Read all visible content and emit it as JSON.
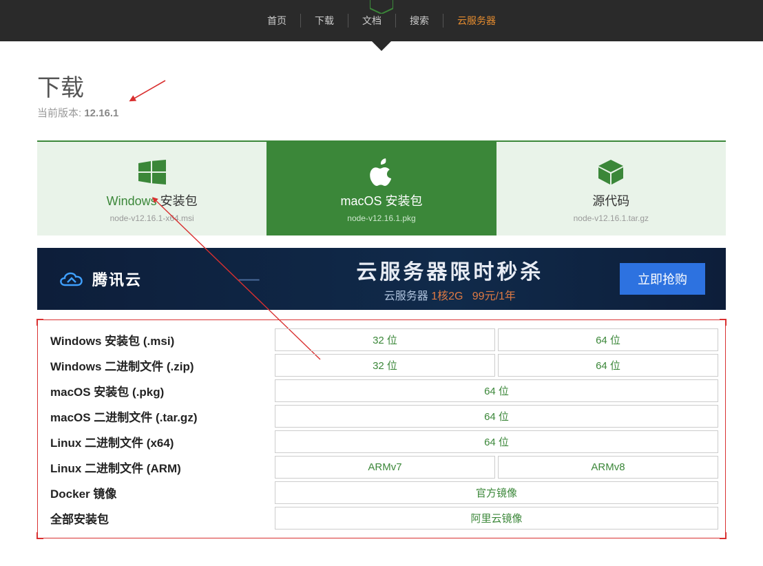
{
  "nav": {
    "items": [
      "首页",
      "下载",
      "文档",
      "搜索",
      "云服务器"
    ],
    "active_index": 4
  },
  "page": {
    "title": "下载",
    "sub_prefix": "当前版本: ",
    "version": "12.16.1"
  },
  "cards": [
    {
      "title_prefix": "Windows ",
      "title_suffix": "安装包",
      "file": "node-v12.16.1-x64.msi",
      "icon": "windows-icon"
    },
    {
      "title_prefix": "macOS ",
      "title_suffix": "安装包",
      "file": "node-v12.16.1.pkg",
      "icon": "apple-icon",
      "active": true
    },
    {
      "title_prefix": "",
      "title_suffix": "源代码",
      "file": "node-v12.16.1.tar.gz",
      "icon": "cube-icon"
    }
  ],
  "banner": {
    "brand": "腾讯云",
    "big_text_a": "云服务器限时",
    "big_text_b": "秒杀",
    "sub_a": "云服务器",
    "sub_b": "1核2G",
    "sub_c": "99元/1年",
    "cta": "立即抢购"
  },
  "table": {
    "rows": [
      {
        "label": "Windows 安装包 (.msi)",
        "cols": [
          "32 位",
          "64 位"
        ]
      },
      {
        "label": "Windows 二进制文件 (.zip)",
        "cols": [
          "32 位",
          "64 位"
        ]
      },
      {
        "label": "macOS 安装包 (.pkg)",
        "cols": [
          "64 位"
        ]
      },
      {
        "label": "macOS 二进制文件 (.tar.gz)",
        "cols": [
          "64 位"
        ]
      },
      {
        "label": "Linux 二进制文件 (x64)",
        "cols": [
          "64 位"
        ]
      },
      {
        "label": "Linux 二进制文件 (ARM)",
        "cols": [
          "ARMv7",
          "ARMv8"
        ]
      },
      {
        "label": "Docker 镜像",
        "cols": [
          "官方镜像"
        ]
      },
      {
        "label": "全部安装包",
        "cols": [
          "阿里云镜像"
        ]
      }
    ]
  }
}
